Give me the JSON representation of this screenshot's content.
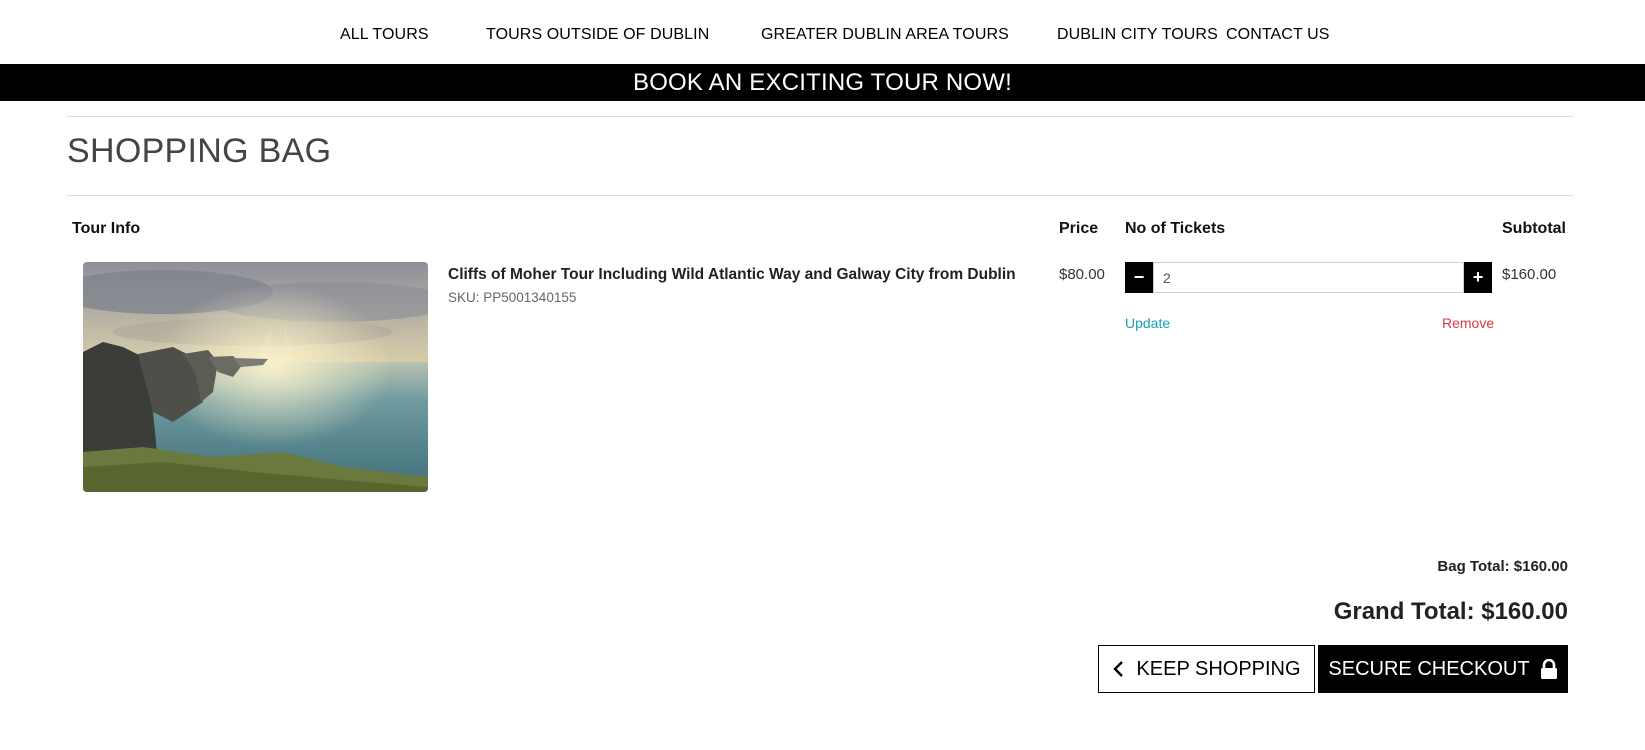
{
  "nav": {
    "items": [
      {
        "label": "ALL TOURS"
      },
      {
        "label": "TOURS OUTSIDE OF DUBLIN"
      },
      {
        "label": "GREATER DUBLIN AREA TOURS"
      },
      {
        "label": "DUBLIN CITY TOURS"
      },
      {
        "label": "CONTACT US"
      }
    ]
  },
  "banner": {
    "text": "BOOK AN EXCITING TOUR NOW!"
  },
  "page": {
    "title": "SHOPPING BAG"
  },
  "table": {
    "headers": {
      "tour_info": "Tour Info",
      "price": "Price",
      "tickets": "No of Tickets",
      "subtotal": "Subtotal"
    },
    "rows": [
      {
        "name": "Cliffs of Moher Tour Including Wild Atlantic Way and Galway City from Dublin",
        "sku": "SKU: PP5001340155",
        "price": "$80.00",
        "quantity": "2",
        "subtotal": "$160.00",
        "update_label": "Update",
        "remove_label": "Remove",
        "decrement_label": "−",
        "increment_label": "+"
      }
    ]
  },
  "totals": {
    "bag_total": "Bag Total: $160.00",
    "grand_total": "Grand Total: $160.00"
  },
  "actions": {
    "keep_shopping": "KEEP SHOPPING",
    "keep_shopping_icon": "chevron-left-icon",
    "secure_checkout": "SECURE CHECKOUT",
    "secure_checkout_icon": "lock-icon"
  },
  "colors": {
    "update": "#17a2b8",
    "remove": "#dc3545",
    "accent": "#000000"
  }
}
